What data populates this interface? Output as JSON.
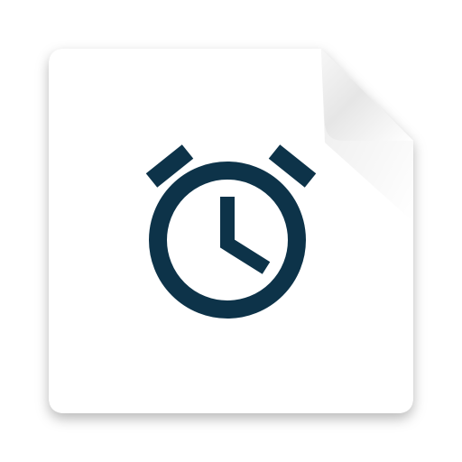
{
  "icon": {
    "name": "alarm-clock-icon",
    "card_color": "#ffffff",
    "fold_color": "#e9e9e9",
    "glyph_color": "#0d3349"
  }
}
